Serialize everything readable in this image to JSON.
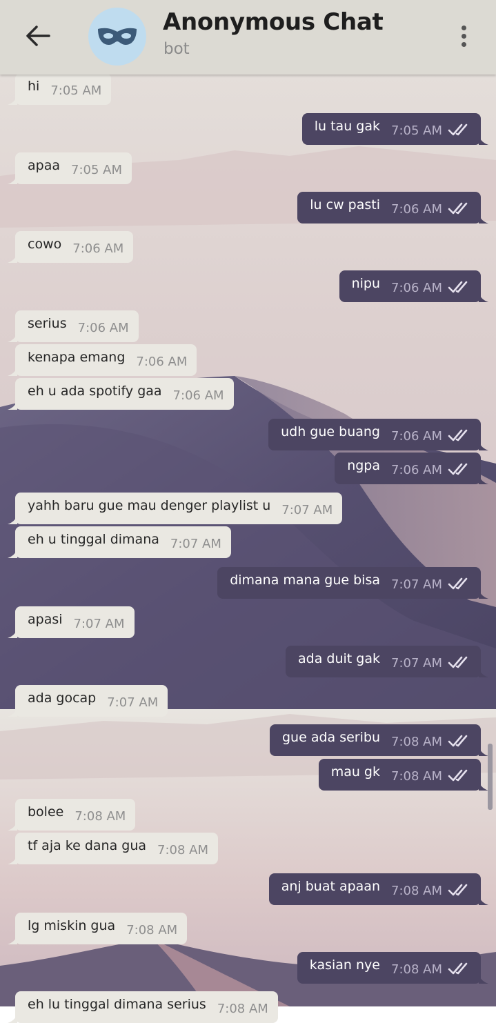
{
  "header": {
    "title": "Anonymous Chat",
    "subtitle": "bot",
    "back_icon": "arrow-left-icon",
    "avatar_icon": "mask-icon",
    "menu_icon": "more-vertical-icon"
  },
  "colors": {
    "header_bg": "#dcdad3",
    "incoming_bubble": "#eae8e2",
    "outgoing_bubble": "#4c4562",
    "avatar_bg": "#bfdcef",
    "mask": "#3c5a78"
  },
  "messages": [
    {
      "dir": "in",
      "text": "hi",
      "time": "7:05 AM"
    },
    {
      "dir": "out",
      "text": "lu tau gak",
      "time": "7:05 AM"
    },
    {
      "dir": "in",
      "text": "apaa",
      "time": "7:05 AM"
    },
    {
      "dir": "out",
      "text": "lu cw pasti",
      "time": "7:06 AM"
    },
    {
      "dir": "in",
      "text": "cowo",
      "time": "7:06 AM"
    },
    {
      "dir": "out",
      "text": "nipu",
      "time": "7:06 AM"
    },
    {
      "dir": "in",
      "text": "serius",
      "time": "7:06 AM"
    },
    {
      "dir": "in",
      "text": "kenapa emang",
      "time": "7:06 AM"
    },
    {
      "dir": "in",
      "text": "eh u ada spotify gaa",
      "time": "7:06 AM"
    },
    {
      "dir": "out",
      "text": "udh gue buang",
      "time": "7:06 AM"
    },
    {
      "dir": "out",
      "text": "ngpa",
      "time": "7:06 AM"
    },
    {
      "dir": "in",
      "text": "yahh baru gue mau denger playlist u",
      "time": "7:07 AM"
    },
    {
      "dir": "in",
      "text": "eh u tinggal dimana",
      "time": "7:07 AM"
    },
    {
      "dir": "out",
      "text": "dimana mana gue bisa",
      "time": "7:07 AM"
    },
    {
      "dir": "in",
      "text": "apasi",
      "time": "7:07 AM"
    },
    {
      "dir": "out",
      "text": "ada duit gak",
      "time": "7:07 AM"
    },
    {
      "dir": "in",
      "text": "ada gocap",
      "time": "7:07 AM"
    },
    {
      "dir": "out",
      "text": "gue ada seribu",
      "time": "7:08 AM"
    },
    {
      "dir": "out",
      "text": "mau gk",
      "time": "7:08 AM"
    },
    {
      "dir": "in",
      "text": "bolee",
      "time": "7:08 AM"
    },
    {
      "dir": "in",
      "text": "tf aja ke dana gua",
      "time": "7:08 AM"
    },
    {
      "dir": "out",
      "text": "anj buat apaan",
      "time": "7:08 AM"
    },
    {
      "dir": "in",
      "text": "lg miskin gua",
      "time": "7:08 AM"
    },
    {
      "dir": "out",
      "text": "kasian nye",
      "time": "7:08 AM"
    },
    {
      "dir": "in",
      "text": "eh lu tinggal dimana serius",
      "time": "7:08 AM"
    }
  ]
}
